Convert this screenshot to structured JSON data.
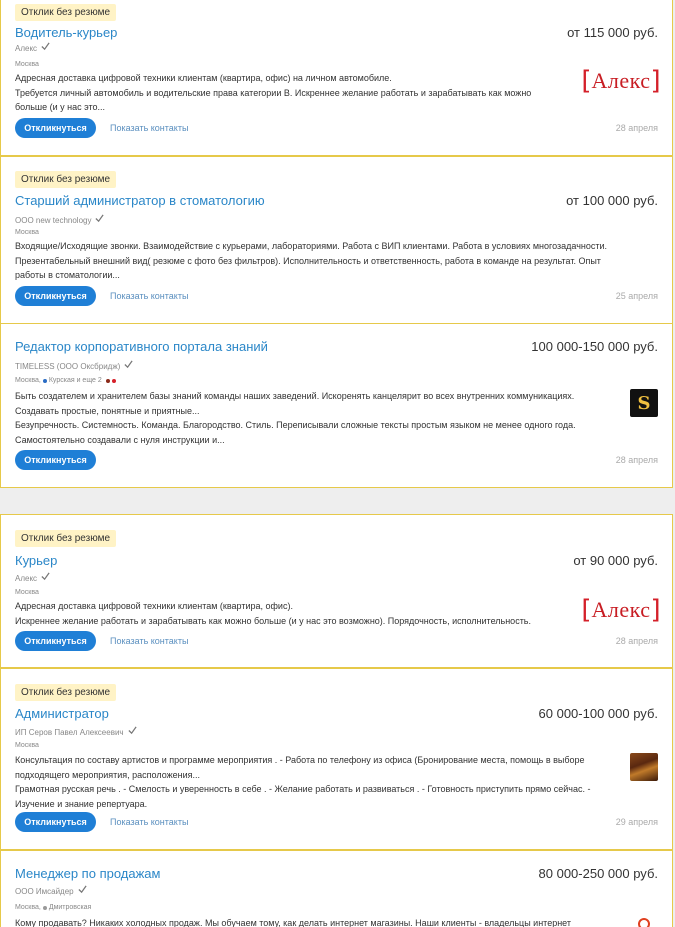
{
  "cards": [
    {
      "badge": "Отклик без резюме",
      "title": "Водитель-курьер",
      "salary": "от 115 000 руб.",
      "company": "Алекс",
      "city": "Москва",
      "desc": [
        "Адресная доставка цифровой техники клиентам (квартира, офис) на личном автомобиле.",
        "Требуется личный автомобиль и водительские права категории B. Искреннее желание работать и зарабатывать как можно",
        "больше (и у нас это..."
      ],
      "respond": "Откликнуться",
      "contacts": "Показать контакты",
      "date": "28 апреля",
      "logo": "Алекс"
    },
    {
      "badge": "Отклик без резюме",
      "title": "Старший администратор в стоматологию",
      "salary": "от 100 000 руб.",
      "company": "ООО new technology",
      "city": "Москва",
      "desc": [
        "Входящие/Исходящие звонки. Взаимодействие с курьерами, лабораториями. Работа с ВИП клиентами. Работа в условиях многозадачности.",
        "Презентабельный внешний вид( резюме с фото без фильтров). Исполнительность и ответственность, работа в команде на результат. Опыт",
        "работы в стоматологии..."
      ],
      "respond": "Откликнуться",
      "contacts": "Показать контакты",
      "date": "25 апреля"
    },
    {
      "title": "Редактор корпоративного портала знаний",
      "salary": "100 000-150 000 руб.",
      "company": "TIMELESS (ООО Оксбридж)",
      "city": "Москва,",
      "metro": "Курская и еще 2",
      "metro_colors": [
        "#2b6cc4",
        "#8b2a1a",
        "#d6202a"
      ],
      "desc": [
        "Быть создателем и хранителем базы знаний команды наших заведений. Искоренять канцелярит во всех внутренних коммуникациях.",
        "Создавать простые, понятные и приятные...",
        "Безупречность. Системность. Команда. Благородство. Стиль. Переписывали сложные тексты простым языком не менее одного года.",
        "Самостоятельно создавали с нуля инструкции и..."
      ],
      "respond": "Откликнуться",
      "date": "28 апреля",
      "logo": "S"
    },
    {
      "badge": "Отклик без резюме",
      "title": "Курьер",
      "salary": "от 90 000 руб.",
      "company": "Алекс",
      "city": "Москва",
      "desc": [
        "Адресная доставка цифровой техники клиентам (квартира, офис).",
        "Искреннее желание работать и зарабатывать как можно больше (и у нас это возможно). Порядочность, исполнительность."
      ],
      "respond": "Откликнуться",
      "contacts": "Показать контакты",
      "date": "28 апреля",
      "logo": "Алекс"
    },
    {
      "badge": "Отклик без резюме",
      "title": "Администратор",
      "salary": "60 000-100 000 руб.",
      "company": "ИП Серов Павел Алексеевич",
      "city": "Москва",
      "desc": [
        "Консультация по составу артистов и программе мероприятия . - Работа по телефону из офиса (Бронирование места, помощь в выборе",
        "подходящего мероприятия, расположения...",
        "Грамотная русская речь . - Смелость и уверенность в себе . - Желание работать и развиваться . - Готовность приступить прямо сейчас. -",
        "Изучение и знание репертуара."
      ],
      "respond": "Откликнуться",
      "contacts": "Показать контакты",
      "date": "29 апреля"
    },
    {
      "title": "Менеджер по продажам",
      "salary": "80 000-250 000 руб.",
      "company": "ООО Имсайдер",
      "city": "Москва,",
      "metro": "Дмитровская",
      "metro_colors": [
        "#9a9a9a"
      ],
      "desc": [
        "Кому продавать? Никаких холодных продаж. Мы обучаем тому, как делать интернет магазины. Наши клиенты - владельцы интернет"
      ]
    }
  ]
}
